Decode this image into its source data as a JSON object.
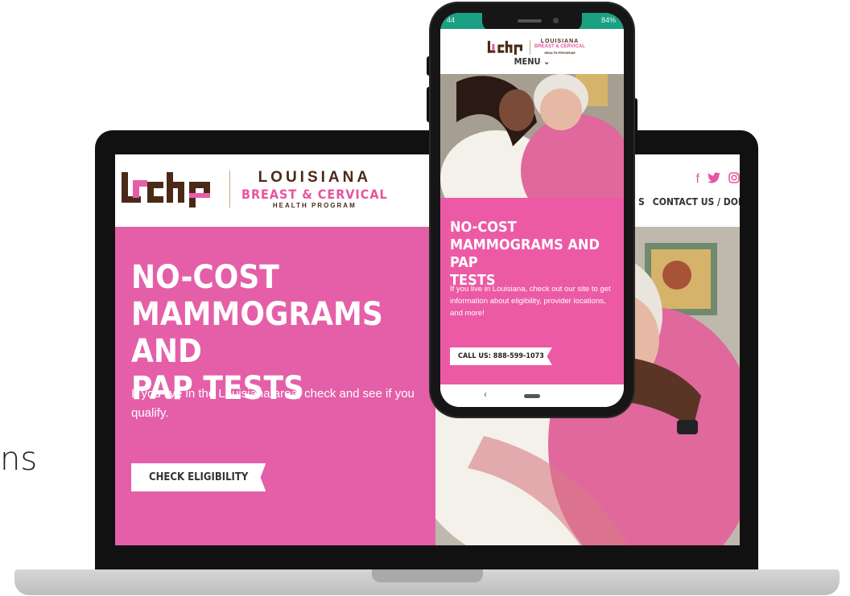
{
  "stray_text": "ns",
  "brand": {
    "mark": "lbchp",
    "line1": "LOUISIANA",
    "line2": "BREAST & CERVICAL",
    "line3": "HEALTH PROGRAM"
  },
  "desktop": {
    "social_icons": [
      "facebook-icon",
      "twitter-icon",
      "instagram-icon"
    ],
    "nav": {
      "partial_item": "S",
      "contact_donate": "CONTACT US / DONATE"
    },
    "hero": {
      "title_line1": "NO-COST",
      "title_line2": "MAMMOGRAMS AND",
      "title_line3": "PAP TESTS",
      "subtitle": "If you live in the Louisiana area, check and see if you qualify.",
      "cta": "CHECK ELIGIBILITY"
    }
  },
  "mobile": {
    "status_left": "44",
    "status_right": "84%",
    "menu": "MENU ⌄",
    "hero": {
      "title_line1": "NO-COST",
      "title_line2": "MAMMOGRAMS AND PAP",
      "title_line3": "TESTS",
      "subtitle": "If you live in Louisiana, check out our site to get information about eligibility, provider locations, and more!",
      "cta": "CALL US: 888-599-1073"
    },
    "nav_back": "‹"
  },
  "colors": {
    "pink": "#e45fa8",
    "brown": "#4a2a17",
    "status_bar": "#1aa082"
  }
}
